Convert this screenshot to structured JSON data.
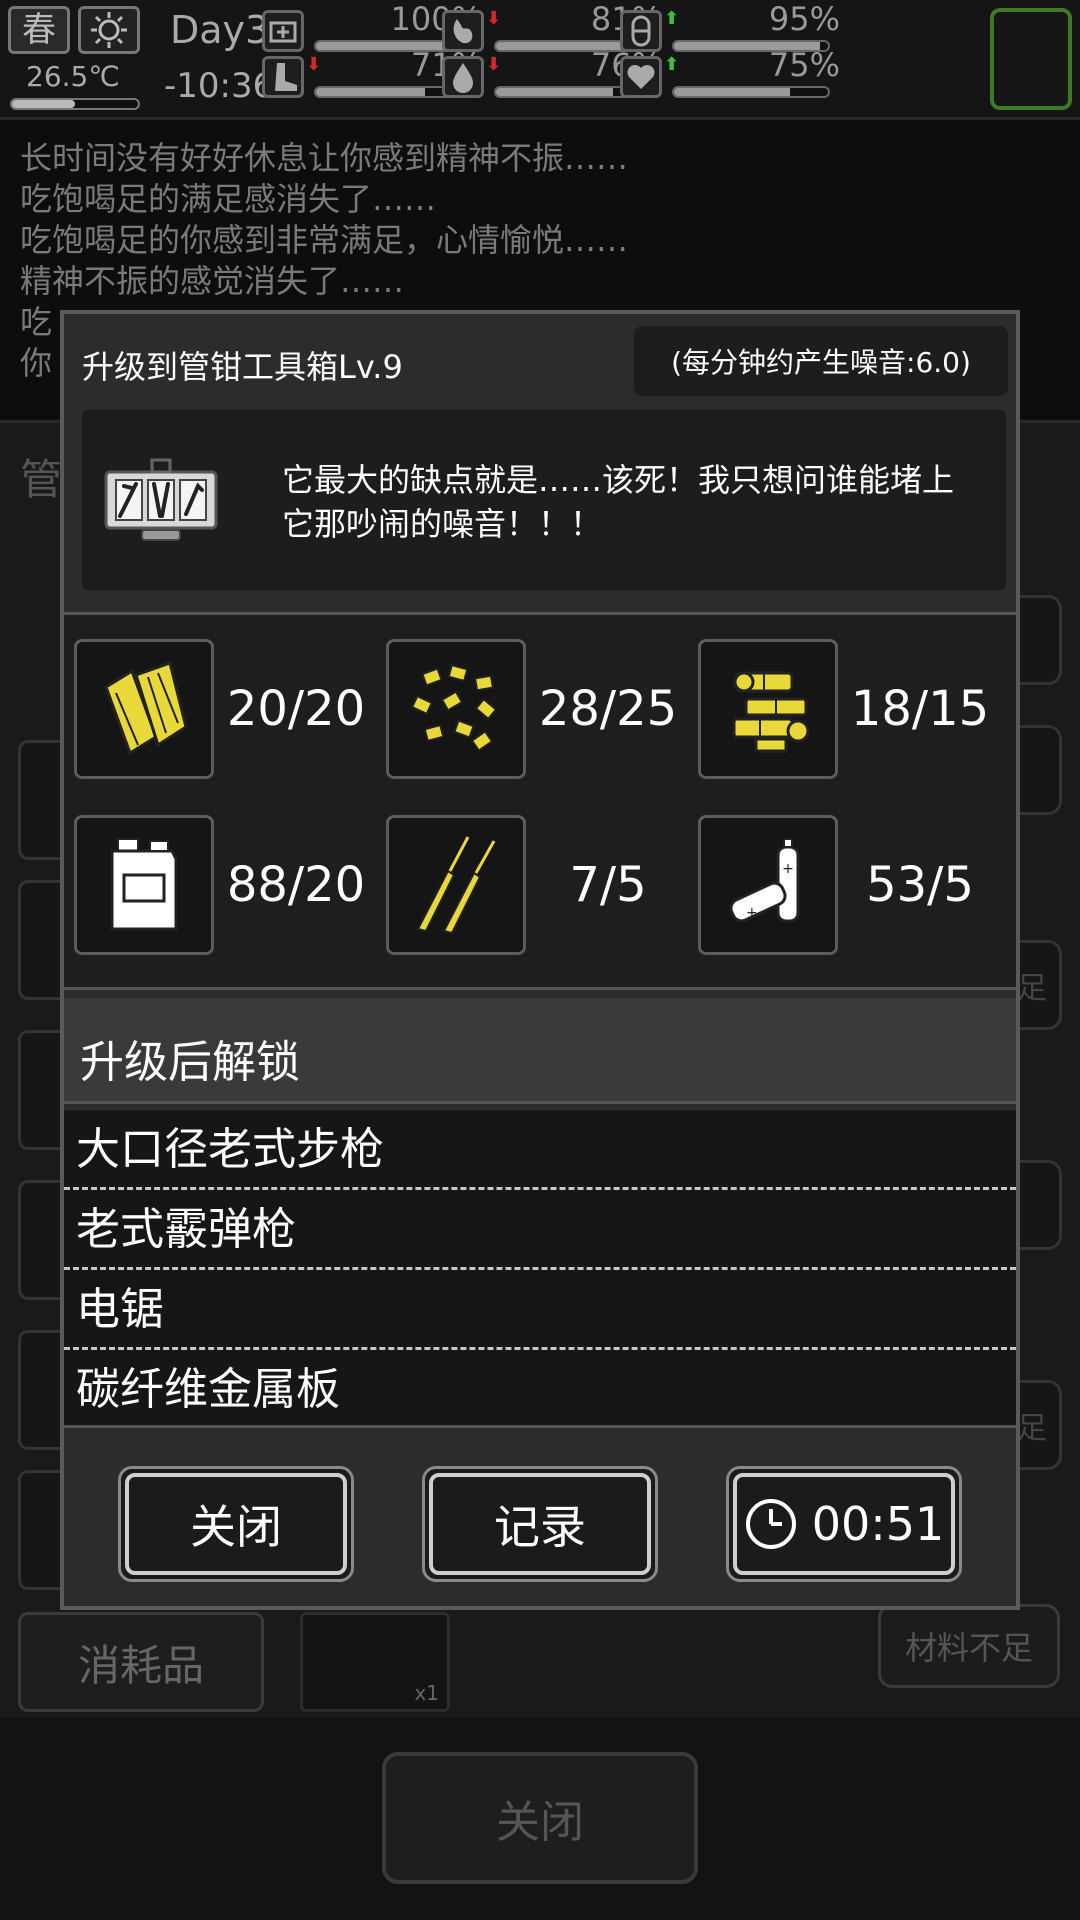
{
  "status": {
    "season": "春",
    "weather_icon": "sun-icon",
    "temperature": "26.5℃",
    "day": "Day35",
    "time": "-10:36-",
    "stats": [
      {
        "name": "health",
        "icon": "medkit-icon",
        "value": "100%",
        "level": 1.0,
        "trend": ""
      },
      {
        "name": "hunger",
        "icon": "stomach-icon",
        "value": "81%",
        "level": 0.81,
        "trend": "down"
      },
      {
        "name": "mood",
        "icon": "brain-icon",
        "value": "95%",
        "level": 0.95,
        "trend": "up"
      },
      {
        "name": "stamina",
        "icon": "boot-icon",
        "value": "71%",
        "level": 0.71,
        "trend": "down"
      },
      {
        "name": "thirst",
        "icon": "water-drop-icon",
        "value": "76%",
        "level": 0.76,
        "trend": "down"
      },
      {
        "name": "spirit",
        "icon": "heart-icon",
        "value": "75%",
        "level": 0.75,
        "trend": "up"
      }
    ]
  },
  "log": [
    "长时间没有好好休息让你感到精神不振……",
    "吃饱喝足的满足感消失了……",
    "吃饱喝足的你感到非常满足，心情愉悦……",
    "精神不振的感觉消失了……",
    "吃",
    "你"
  ],
  "background": {
    "title": "管",
    "consumable_tab": "消耗品",
    "item_count": "x1",
    "material_button": "材料不足",
    "right_labels": [
      "足",
      "足"
    ],
    "close_button": "关闭"
  },
  "dialog": {
    "title": "升级到管钳工具箱Lv.9",
    "noise": "(每分钟约产生噪音:6.0)",
    "description": "它最大的缺点就是……该死！我只想问谁能堵上它那吵闹的噪音！！！",
    "requirements": [
      {
        "icon": "wood-plank-icon",
        "count": "20/20"
      },
      {
        "icon": "scrap-pieces-icon",
        "count": "28/25"
      },
      {
        "icon": "mechanical-parts-icon",
        "count": "18/15"
      },
      {
        "icon": "fuel-canister-icon",
        "count": "88/20"
      },
      {
        "icon": "wire-sticks-icon",
        "count": "7/5"
      },
      {
        "icon": "batteries-icon",
        "count": "53/5"
      }
    ],
    "unlock_header": "升级后解锁",
    "unlocks": [
      "大口径老式步枪",
      "老式霰弹枪",
      "电锯",
      "碳纤维金属板"
    ],
    "buttons": {
      "close": "关闭",
      "record": "记录",
      "timer": "00:51"
    }
  },
  "colors": {
    "accent_yellow": "#e8d83a",
    "trend_up": "#3fbf3f",
    "trend_down": "#d02a2a",
    "character_frame": "#3d7a26"
  }
}
